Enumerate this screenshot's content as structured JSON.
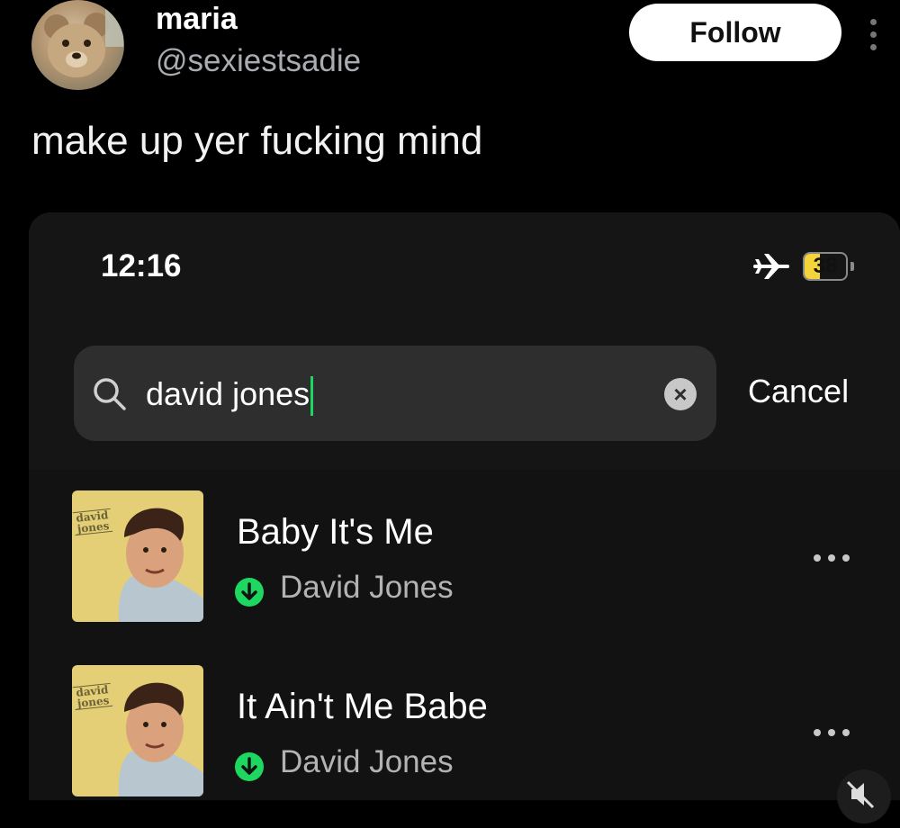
{
  "post": {
    "display_name": "maria",
    "handle": "@sexiestsadie",
    "follow_label": "Follow",
    "text": "make up yer fucking mind"
  },
  "embed": {
    "status_bar": {
      "time": "12:16",
      "battery_level": "38",
      "battery_percent": 38
    },
    "search": {
      "query": "david jones",
      "cancel_label": "Cancel"
    },
    "results": [
      {
        "title": "Baby It's Me",
        "artist": "David Jones",
        "art_text": "david jones"
      },
      {
        "title": "It Ain't Me Babe",
        "artist": "David Jones",
        "art_text": "david jones"
      }
    ]
  },
  "colors": {
    "accent_green": "#1ed760",
    "battery_yellow": "#f4d33b",
    "background": "#000000",
    "card": "#151515"
  }
}
